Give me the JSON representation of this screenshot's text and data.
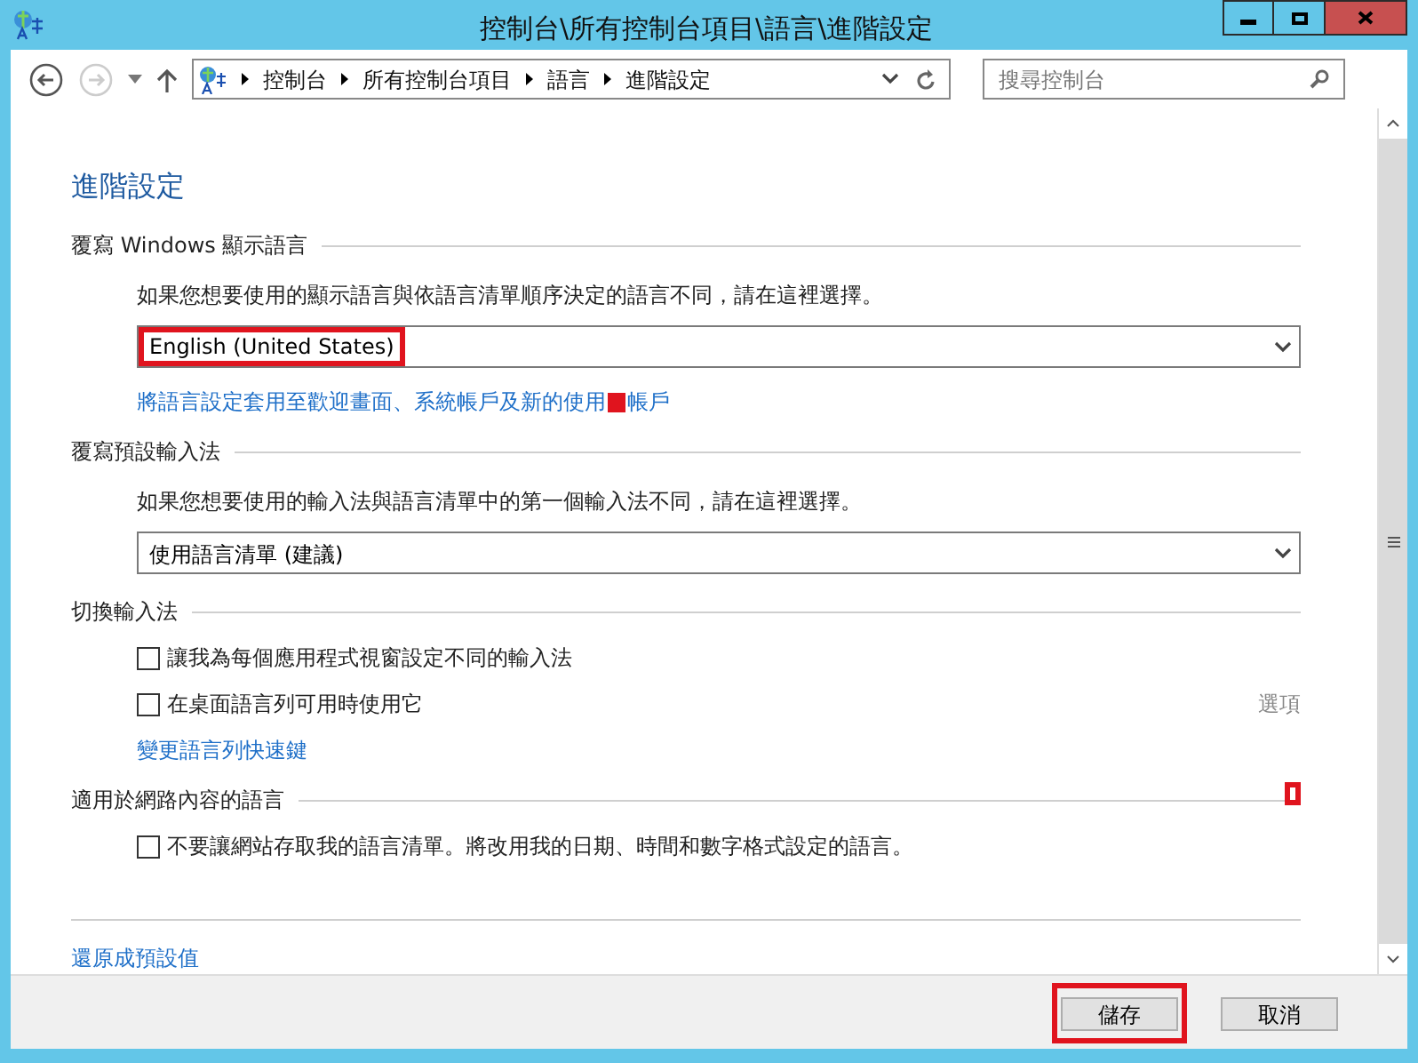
{
  "window": {
    "title": "控制台\\所有控制台項目\\語言\\進階設定"
  },
  "breadcrumb": [
    "控制台",
    "所有控制台項目",
    "語言",
    "進階設定"
  ],
  "search": {
    "placeholder": "搜尋控制台"
  },
  "page_title": "進階設定",
  "sections": [
    {
      "title": "覆寫 Windows 顯示語言",
      "items": [
        {
          "kind": "text",
          "text": "如果您想要使用的顯示語言與依語言清單順序決定的語言不同，請在這裡選擇。"
        },
        {
          "kind": "dropdown",
          "value": "English (United States)",
          "highlighted": true
        },
        {
          "kind": "link",
          "parts": [
            "將語言設定套用至歡迎畫面、系統帳戶及新的使用",
            "帳戶"
          ],
          "marked": true
        }
      ]
    },
    {
      "title": "覆寫預設輸入法",
      "items": [
        {
          "kind": "text",
          "text": "如果您想要使用的輸入法與語言清單中的第一個輸入法不同，請在這裡選擇。"
        },
        {
          "kind": "dropdown",
          "value": "使用語言清單 (建議)",
          "highlighted": false
        }
      ]
    },
    {
      "title": "切換輸入法",
      "items": [
        {
          "kind": "checkbox",
          "label": "讓我為每個應用程式視窗設定不同的輸入法",
          "checked": false
        },
        {
          "kind": "checkbox",
          "label": "在桌面語言列可用時使用它",
          "checked": false,
          "option": "選項"
        },
        {
          "kind": "link",
          "parts": [
            "變更語言列快速鍵"
          ],
          "marked": false
        }
      ]
    },
    {
      "title": "適用於網路內容的語言",
      "marked": true,
      "items": [
        {
          "kind": "checkbox",
          "label": "不要讓網站存取我的語言清單。將改用我的日期、時間和數字格式設定的語言。",
          "checked": false
        }
      ]
    }
  ],
  "reset_link": "還原成預設值",
  "buttons": [
    {
      "label": "儲存",
      "highlighted": true
    },
    {
      "label": "取消",
      "highlighted": false
    }
  ]
}
